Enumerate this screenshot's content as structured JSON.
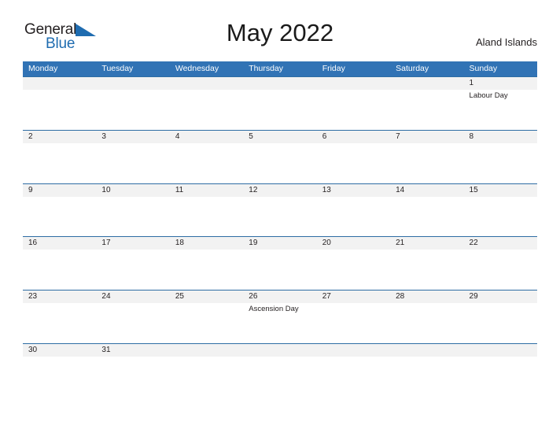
{
  "brand": {
    "name_part1": "General",
    "name_part2": "Blue",
    "flag_icon": "flag-triangle-icon",
    "color_dark": "#231f20",
    "color_blue": "#1f6cb0"
  },
  "header": {
    "title": "May 2022",
    "region": "Aland Islands"
  },
  "theme": {
    "header_blue": "#3173b5",
    "row_band_gray": "#f2f2f2",
    "row_border_blue": "#2e6da4",
    "text_dark": "#231f20"
  },
  "calendar": {
    "weekdays": [
      "Monday",
      "Tuesday",
      "Wednesday",
      "Thursday",
      "Friday",
      "Saturday",
      "Sunday"
    ],
    "weeks": [
      [
        {
          "day": "",
          "event": ""
        },
        {
          "day": "",
          "event": ""
        },
        {
          "day": "",
          "event": ""
        },
        {
          "day": "",
          "event": ""
        },
        {
          "day": "",
          "event": ""
        },
        {
          "day": "",
          "event": ""
        },
        {
          "day": "1",
          "event": "Labour Day"
        }
      ],
      [
        {
          "day": "2",
          "event": ""
        },
        {
          "day": "3",
          "event": ""
        },
        {
          "day": "4",
          "event": ""
        },
        {
          "day": "5",
          "event": ""
        },
        {
          "day": "6",
          "event": ""
        },
        {
          "day": "7",
          "event": ""
        },
        {
          "day": "8",
          "event": ""
        }
      ],
      [
        {
          "day": "9",
          "event": ""
        },
        {
          "day": "10",
          "event": ""
        },
        {
          "day": "11",
          "event": ""
        },
        {
          "day": "12",
          "event": ""
        },
        {
          "day": "13",
          "event": ""
        },
        {
          "day": "14",
          "event": ""
        },
        {
          "day": "15",
          "event": ""
        }
      ],
      [
        {
          "day": "16",
          "event": ""
        },
        {
          "day": "17",
          "event": ""
        },
        {
          "day": "18",
          "event": ""
        },
        {
          "day": "19",
          "event": ""
        },
        {
          "day": "20",
          "event": ""
        },
        {
          "day": "21",
          "event": ""
        },
        {
          "day": "22",
          "event": ""
        }
      ],
      [
        {
          "day": "23",
          "event": ""
        },
        {
          "day": "24",
          "event": ""
        },
        {
          "day": "25",
          "event": ""
        },
        {
          "day": "26",
          "event": "Ascension Day"
        },
        {
          "day": "27",
          "event": ""
        },
        {
          "day": "28",
          "event": ""
        },
        {
          "day": "29",
          "event": ""
        }
      ],
      [
        {
          "day": "30",
          "event": ""
        },
        {
          "day": "31",
          "event": ""
        },
        {
          "day": "",
          "event": ""
        },
        {
          "day": "",
          "event": ""
        },
        {
          "day": "",
          "event": ""
        },
        {
          "day": "",
          "event": ""
        },
        {
          "day": "",
          "event": ""
        }
      ]
    ]
  }
}
